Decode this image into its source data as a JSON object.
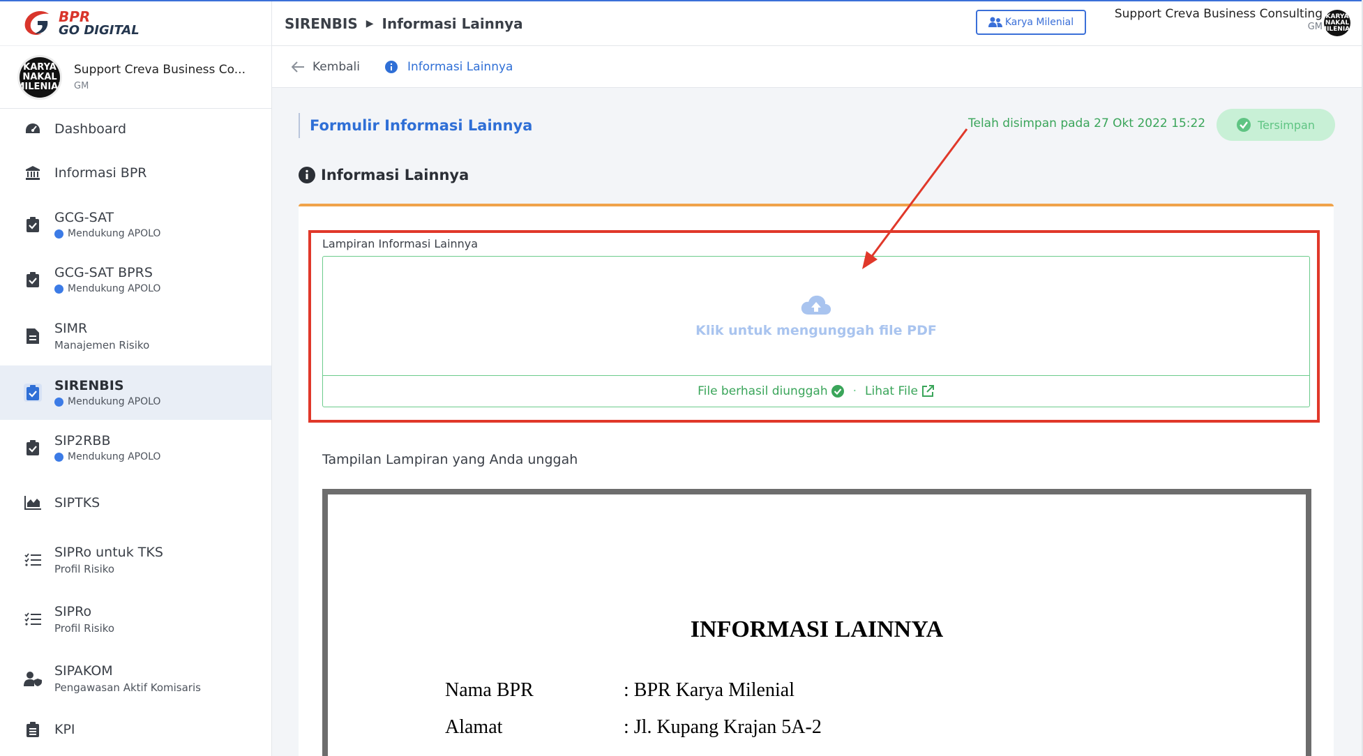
{
  "brand": {
    "line1": "BPR",
    "line2": "GO DIGITAL"
  },
  "sidebar": {
    "profile": {
      "avatar_text": "KARYA NAKAL MILENIAL",
      "name": "Support Creva Business Co...",
      "role": "GM"
    },
    "items": [
      {
        "label": "Dashboard",
        "sub": ""
      },
      {
        "label": "Informasi BPR",
        "sub": ""
      },
      {
        "label": "GCG-SAT",
        "sub": "Mendukung APOLO"
      },
      {
        "label": "GCG-SAT BPRS",
        "sub": "Mendukung APOLO"
      },
      {
        "label": "SIMR",
        "sub": "Manajemen Risiko"
      },
      {
        "label": "SIRENBIS",
        "sub": "Mendukung APOLO"
      },
      {
        "label": "SIP2RBB",
        "sub": "Mendukung APOLO"
      },
      {
        "label": "SIPTKS",
        "sub": ""
      },
      {
        "label": "SIPRo untuk TKS",
        "sub": "Profil Risiko"
      },
      {
        "label": "SIPRo",
        "sub": "Profil Risiko"
      },
      {
        "label": "SIPAKOM",
        "sub": "Pengawasan Aktif Komisaris"
      },
      {
        "label": "KPI",
        "sub": ""
      }
    ]
  },
  "header": {
    "crumb_root": "SIRENBIS",
    "crumb_current": "Informasi Lainnya",
    "karya_button": "Karya Milenial",
    "user_name": "Support Creva Business Consulting",
    "user_role": "GM",
    "avatar_text": "KARYA NAKAL MILENIAL"
  },
  "subnav": {
    "back": "Kembali",
    "current": "Informasi Lainnya"
  },
  "main": {
    "form_title": "Formulir Informasi Lainnya",
    "saved_text": "Telah disimpan pada 27 Okt 2022 15:22",
    "saved_button": "Tersimpan",
    "section_title": "Informasi Lainnya",
    "upload_label": "Lampiran Informasi Lainnya",
    "upload_hint": "Klik untuk mengunggah file PDF",
    "upload_status": "File berhasil diunggah",
    "view_file": "Lihat File",
    "preview_title": "Tampilan Lampiran yang Anda unggah",
    "pdf": {
      "heading": "INFORMASI LAINNYA",
      "rows": [
        {
          "key": "Nama BPR",
          "value": ": BPR Karya Milenial"
        },
        {
          "key": "Alamat",
          "value": ": Jl. Kupang Krajan 5A-2"
        }
      ]
    }
  },
  "colors": {
    "accent": "#2f6fd6",
    "success": "#3aa55a",
    "annotation": "#e0382a",
    "card_top": "#f0a34a"
  }
}
